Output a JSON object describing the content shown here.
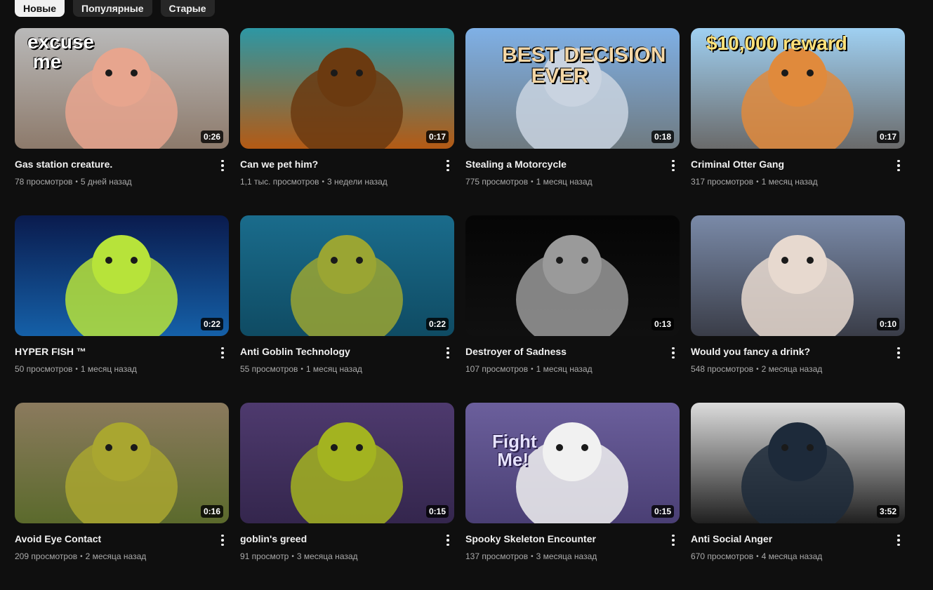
{
  "filters": [
    {
      "label": "Новые",
      "active": true
    },
    {
      "label": "Популярные",
      "active": false
    },
    {
      "label": "Старые",
      "active": false
    }
  ],
  "videos": [
    {
      "title": "Gas station creature.",
      "views": "78 просмотров",
      "age": "5 дней назад",
      "duration": "0:26",
      "overlay": "excuse\n me",
      "bg": [
        "#b9b9b9",
        "#8d7a6b"
      ],
      "accent": "#e7a58e"
    },
    {
      "title": "Can we pet him?",
      "views": "1,1 тыс. просмотров",
      "age": "3 недели назад",
      "duration": "0:17",
      "overlay": "",
      "bg": [
        "#2d97a4",
        "#b45a14"
      ],
      "accent": "#6b3a10"
    },
    {
      "title": "Stealing a Motorcycle",
      "views": "775 просмотров",
      "age": "1 месяц назад",
      "duration": "0:18",
      "overlay": "BEST DECISION\n     EVER",
      "bg": [
        "#7fb0e6",
        "#6f7a80"
      ],
      "accent": "#c9d3e0"
    },
    {
      "title": "Criminal Otter Gang",
      "views": "317 просмотров",
      "age": "1 месяц назад",
      "duration": "0:17",
      "overlay": "$10,000 reward",
      "bg": [
        "#9fd0f2",
        "#6a6a6a"
      ],
      "accent": "#e08a3c"
    },
    {
      "title": "HYPER FISH ™",
      "views": "50 просмотров",
      "age": "1 месяц назад",
      "duration": "0:22",
      "overlay": "",
      "bg": [
        "#0a1b4d",
        "#1560a8"
      ],
      "accent": "#b7e33a"
    },
    {
      "title": "Anti Goblin Technology",
      "views": "55 просмотров",
      "age": "1 месяц назад",
      "duration": "0:22",
      "overlay": "",
      "bg": [
        "#1a6c8c",
        "#0f4b63"
      ],
      "accent": "#9aa533"
    },
    {
      "title": "Destroyer of Sadness",
      "views": "107 просмотров",
      "age": "1 месяц назад",
      "duration": "0:13",
      "overlay": "",
      "bg": [
        "#050505",
        "#101010"
      ],
      "accent": "#9a9a9a"
    },
    {
      "title": "Would you fancy a drink?",
      "views": "548 просмотров",
      "age": "2 месяца назад",
      "duration": "0:10",
      "overlay": "",
      "bg": [
        "#7a8aa8",
        "#3a3d48"
      ],
      "accent": "#e7d9cf"
    },
    {
      "title": "Avoid Eye Contact",
      "views": "209 просмотров",
      "age": "2 месяца назад",
      "duration": "0:16",
      "overlay": "",
      "bg": [
        "#8b7a5e",
        "#5b6a2c"
      ],
      "accent": "#a9a630"
    },
    {
      "title": "goblin's greed",
      "views": "91 просмотр",
      "age": "3 месяца назад",
      "duration": "0:15",
      "overlay": "",
      "bg": [
        "#4e3a6e",
        "#34264d"
      ],
      "accent": "#a3b320"
    },
    {
      "title": "Spooky Skeleton Encounter",
      "views": "137 просмотров",
      "age": "3 месяца назад",
      "duration": "0:15",
      "overlay": "Fight\n Me!",
      "bg": [
        "#6b5f9c",
        "#4a3f74"
      ],
      "accent": "#f1f1f1"
    },
    {
      "title": "Anti Social Anger",
      "views": "670 просмотров",
      "age": "4 месяца назад",
      "duration": "3:52",
      "overlay": "",
      "bg": [
        "#dcdcdc",
        "#202020"
      ],
      "accent": "#1d2a3a"
    }
  ]
}
